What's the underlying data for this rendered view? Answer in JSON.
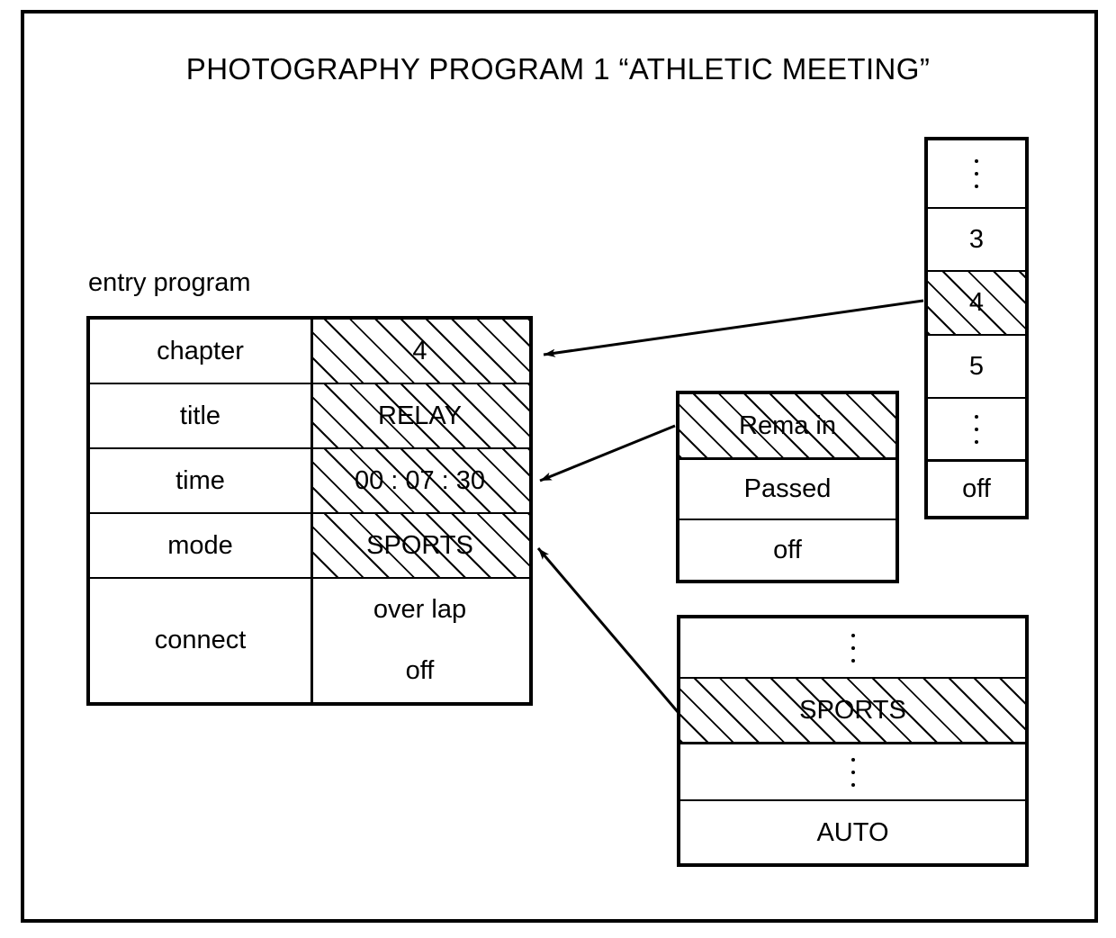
{
  "figure": {
    "title": "PHOTOGRAPHY PROGRAM 1 “ATHLETIC MEETING”",
    "entry_program_label": "entry program"
  },
  "entry_program_table": {
    "rows": [
      {
        "label": "chapter",
        "value": "4",
        "highlighted": true
      },
      {
        "label": "title",
        "value": "RELAY",
        "highlighted": true
      },
      {
        "label": "time",
        "value": "00 : 07 : 30",
        "highlighted": true
      },
      {
        "label": "mode",
        "value": "SPORTS",
        "highlighted": true
      }
    ],
    "connect": {
      "label": "connect",
      "values": [
        "over lap",
        "off"
      ]
    }
  },
  "chapter_list": {
    "items": [
      {
        "text": "",
        "dots": true,
        "highlighted": false
      },
      {
        "text": "3",
        "dots": false,
        "highlighted": false
      },
      {
        "text": "4",
        "dots": false,
        "highlighted": true
      },
      {
        "text": "5",
        "dots": false,
        "highlighted": false
      },
      {
        "text": "",
        "dots": true,
        "highlighted": false
      },
      {
        "text": "off",
        "dots": false,
        "highlighted": false
      }
    ]
  },
  "time_display_list": {
    "items": [
      {
        "text": "Rema in",
        "highlighted": true
      },
      {
        "text": "Passed",
        "highlighted": false
      },
      {
        "text": "off",
        "highlighted": false
      }
    ]
  },
  "mode_list": {
    "items": [
      {
        "text": "",
        "dots": true,
        "highlighted": false
      },
      {
        "text": "SPORTS",
        "dots": false,
        "highlighted": true
      },
      {
        "text": "",
        "dots": true,
        "highlighted": false
      },
      {
        "text": "AUTO",
        "dots": false,
        "highlighted": false
      }
    ]
  },
  "colors": {
    "ink": "#000000",
    "paper": "#ffffff"
  }
}
